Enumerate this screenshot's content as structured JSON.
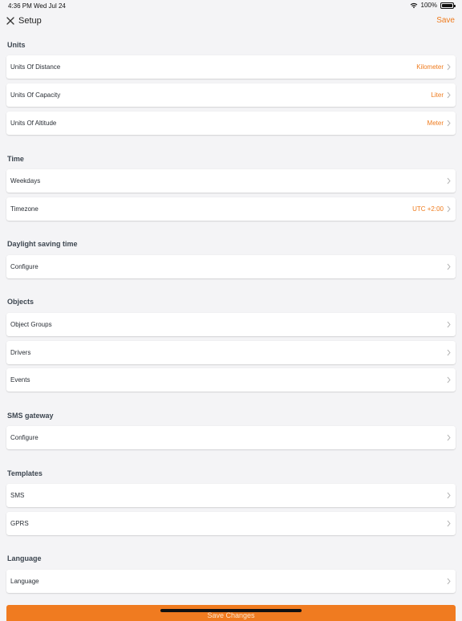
{
  "status_bar": {
    "time": "4:36 PM",
    "date": "Wed Jul 24",
    "battery": "100%"
  },
  "nav": {
    "title": "Setup",
    "save_label": "Save"
  },
  "sections": [
    {
      "title": "Units",
      "rows": [
        {
          "label": "Units Of Distance",
          "value": "Kilometer"
        },
        {
          "label": "Units Of Capacity",
          "value": "Liter"
        },
        {
          "label": "Units Of Altitude",
          "value": "Meter"
        }
      ]
    },
    {
      "title": "Time",
      "rows": [
        {
          "label": "Weekdays",
          "value": ""
        },
        {
          "label": "Timezone",
          "value": "UTC +2:00"
        }
      ]
    },
    {
      "title": "Daylight saving time",
      "rows": [
        {
          "label": "Configure",
          "value": ""
        }
      ]
    },
    {
      "title": "Objects",
      "rows": [
        {
          "label": "Object Groups",
          "value": ""
        },
        {
          "label": "Drivers",
          "value": ""
        },
        {
          "label": "Events",
          "value": ""
        }
      ]
    },
    {
      "title": "SMS gateway",
      "rows": [
        {
          "label": "Configure",
          "value": ""
        }
      ]
    },
    {
      "title": "Templates",
      "rows": [
        {
          "label": "SMS",
          "value": ""
        },
        {
          "label": "GPRS",
          "value": ""
        }
      ]
    },
    {
      "title": "Language",
      "rows": [
        {
          "label": "Language",
          "value": ""
        }
      ]
    }
  ],
  "footer": {
    "save_changes_label": "Save Changes"
  },
  "colors": {
    "accent": "#ef7b1d",
    "background": "#f4f4f6"
  }
}
